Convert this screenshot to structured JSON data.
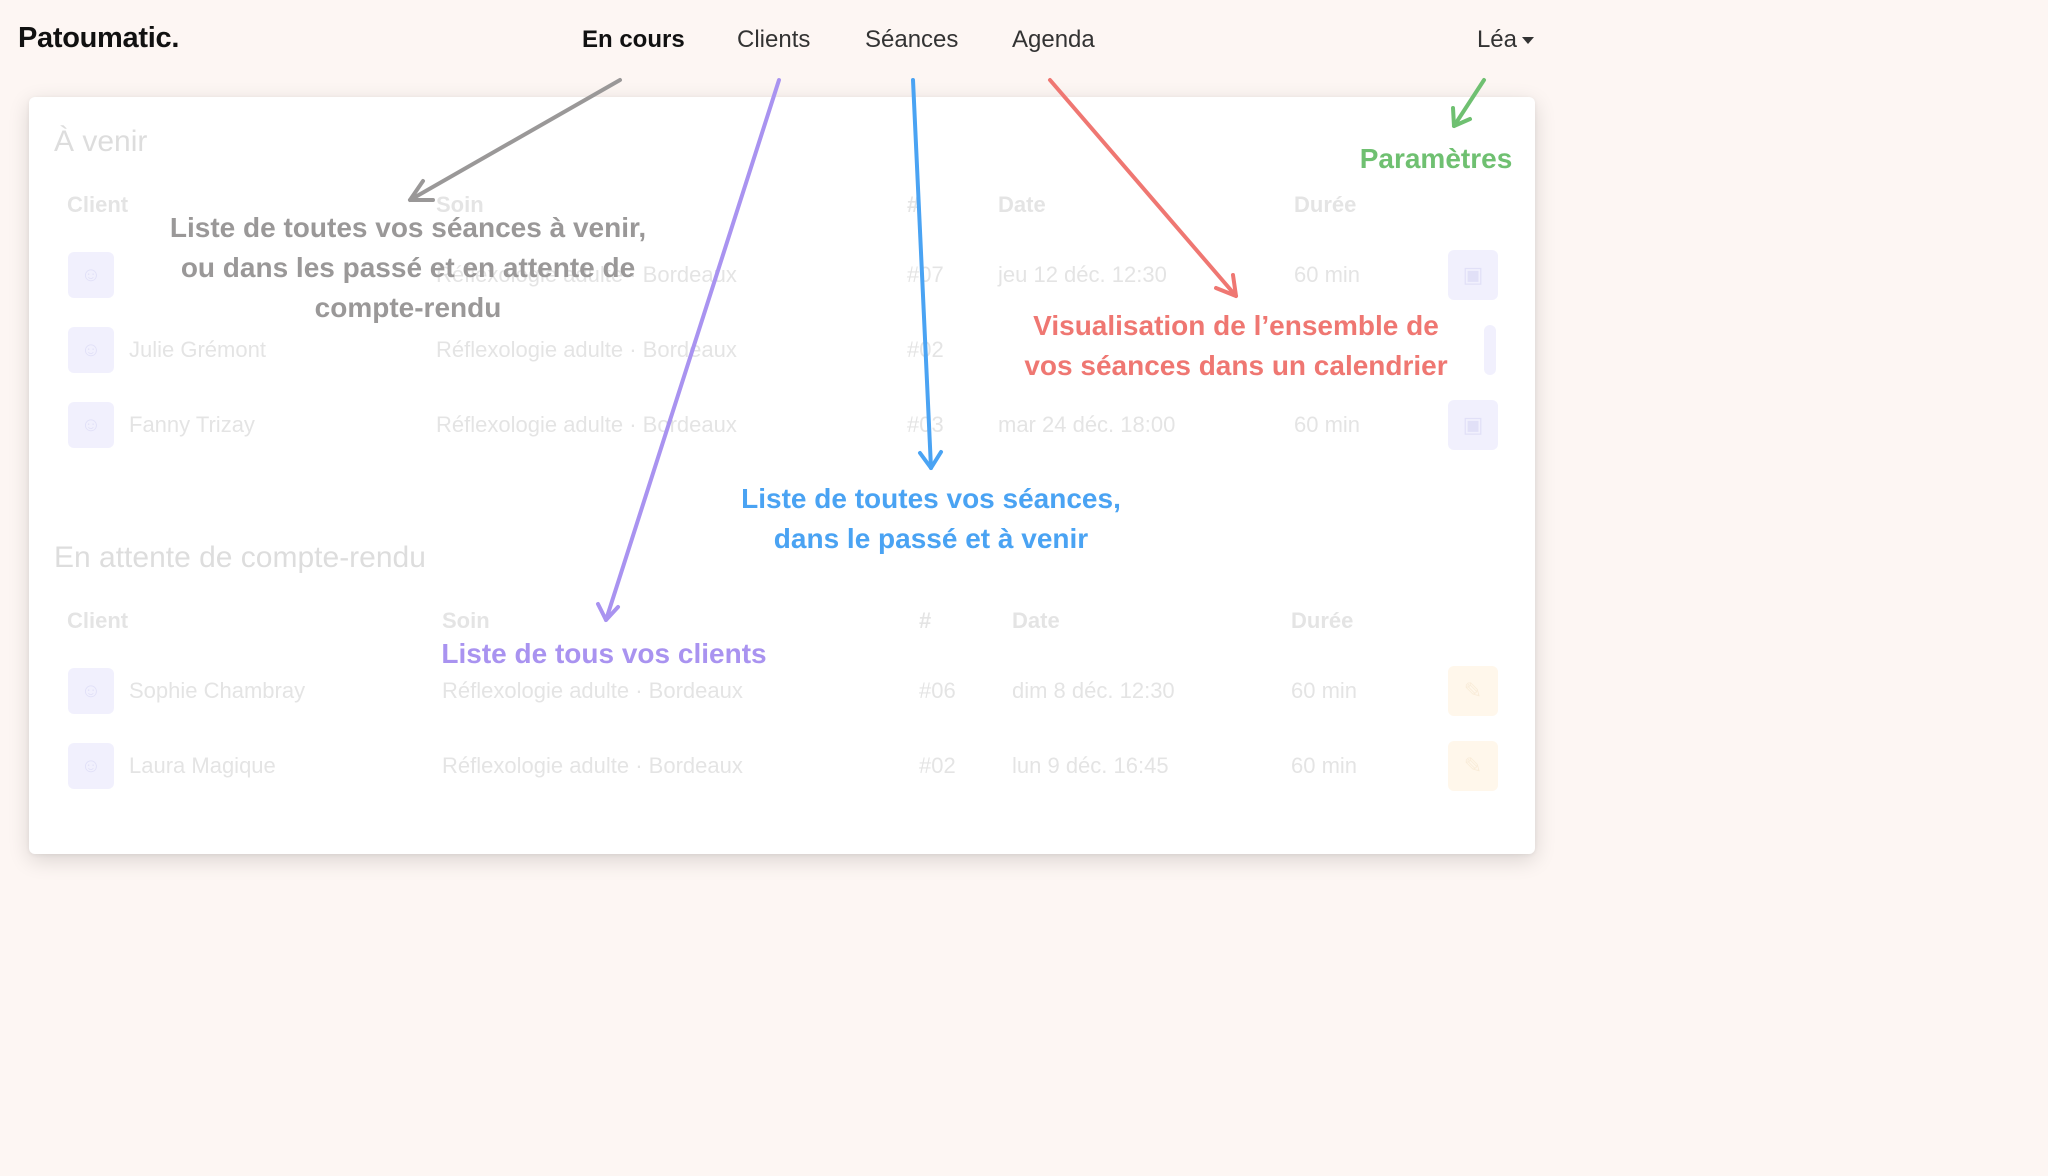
{
  "navbar": {
    "brand": "Patoumatic.",
    "links": [
      "En cours",
      "Clients",
      "Séances",
      "Agenda"
    ],
    "user": "Léa"
  },
  "upcoming": {
    "title": "À venir",
    "headers": {
      "client": "Client",
      "soin": "Soin",
      "num": "#",
      "date": "Date",
      "duree": "Durée"
    },
    "rows": [
      {
        "client": "",
        "soin": "Réflexologie adulte · Bordeaux",
        "num": "#07",
        "date": "jeu 12 déc. 12:30",
        "duree": "60 min"
      },
      {
        "client": "Julie Grémont",
        "soin": "Réflexologie adulte · Bordeaux",
        "num": "#02",
        "date": "",
        "duree": ""
      },
      {
        "client": "Fanny Trizay",
        "soin": "Réflexologie adulte · Bordeaux",
        "num": "#03",
        "date": "mar 24 déc. 18:00",
        "duree": "60 min"
      }
    ]
  },
  "pending": {
    "title": "En attente de compte-rendu",
    "headers": {
      "client": "Client",
      "soin": "Soin",
      "num": "#",
      "date": "Date",
      "duree": "Durée"
    },
    "rows": [
      {
        "client": "Sophie Chambray",
        "soin": "Réflexologie adulte · Bordeaux",
        "num": "#06",
        "date": "dim 8 déc. 12:30",
        "duree": "60 min"
      },
      {
        "client": "Laura Magique",
        "soin": "Réflexologie adulte · Bordeaux",
        "num": "#02",
        "date": "lun 9 déc. 16:45",
        "duree": "60 min"
      }
    ]
  },
  "annotations": {
    "en_cours": [
      "Liste de toutes vos séances à venir,",
      "ou dans les passé et en attente de",
      "compte-rendu"
    ],
    "clients": "Liste de tous vos clients",
    "seances": [
      "Liste de toutes vos séances,",
      "dans le passé et à venir"
    ],
    "agenda": [
      "Visualisation de l’ensemble de",
      "vos séances dans un calendrier"
    ],
    "parametres": "Paramètres"
  },
  "colors": {
    "gray": "#9a9898",
    "purple": "#a993f0",
    "blue": "#4aa3f3",
    "red": "#ef7772",
    "green": "#6fc071",
    "background": "#fdf6f3"
  },
  "icons": {
    "client_icon": "user-icon",
    "row_action": "calendar-icon",
    "pending_action": "document-icon",
    "user_menu": "caret-down-icon"
  }
}
